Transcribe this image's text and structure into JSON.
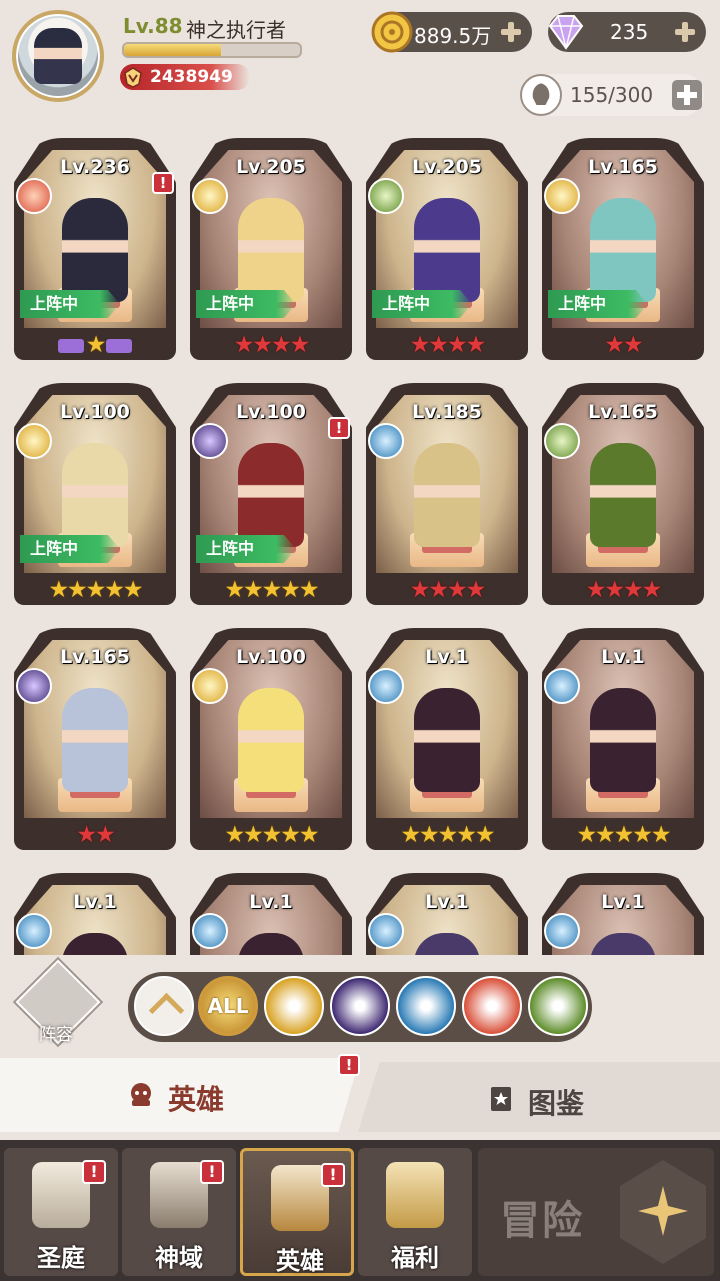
{
  "player": {
    "level": "Lv.88",
    "name": "神之执行者",
    "exp_fraction": 0.55,
    "power": "2438949"
  },
  "currency": {
    "gold": "889.5万",
    "diamond": "235"
  },
  "hero_capacity": "155/300",
  "heroes": [
    {
      "level": "Lv.236",
      "faction": "fire",
      "deployed": true,
      "alert": true,
      "stars": "★",
      "star_color": "purple",
      "sprite": "#2b2a3d"
    },
    {
      "level": "Lv.205",
      "faction": "holy",
      "deployed": true,
      "alert": false,
      "stars": "★★★★",
      "star_color": "red",
      "sprite": "#f0d38a"
    },
    {
      "level": "Lv.205",
      "faction": "nature",
      "deployed": true,
      "alert": false,
      "stars": "★★★★",
      "star_color": "red",
      "sprite": "#4c3a8c"
    },
    {
      "level": "Lv.165",
      "faction": "holy",
      "deployed": true,
      "alert": false,
      "stars": "★★",
      "star_color": "red",
      "sprite": "#7fc6c0"
    },
    {
      "level": "Lv.100",
      "faction": "holy",
      "deployed": true,
      "alert": false,
      "stars": "★★★★★",
      "star_color": "gold",
      "sprite": "#e9d9a8"
    },
    {
      "level": "Lv.100",
      "faction": "dark",
      "deployed": true,
      "alert": true,
      "stars": "★★★★★",
      "star_color": "gold",
      "sprite": "#8c2b2b"
    },
    {
      "level": "Lv.185",
      "faction": "order",
      "deployed": false,
      "alert": false,
      "stars": "★★★★",
      "star_color": "red",
      "sprite": "#d8c288"
    },
    {
      "level": "Lv.165",
      "faction": "nature",
      "deployed": false,
      "alert": false,
      "stars": "★★★★",
      "star_color": "red",
      "sprite": "#5b7a2c"
    },
    {
      "level": "Lv.165",
      "faction": "dark",
      "deployed": false,
      "alert": false,
      "stars": "★★",
      "star_color": "red",
      "sprite": "#b8c2d8"
    },
    {
      "level": "Lv.100",
      "faction": "holy",
      "deployed": false,
      "alert": false,
      "stars": "★★★★★",
      "star_color": "gold",
      "sprite": "#f4df7a"
    },
    {
      "level": "Lv.1",
      "faction": "order",
      "deployed": false,
      "alert": false,
      "stars": "★★★★★",
      "star_color": "gold",
      "sprite": "#3a2230"
    },
    {
      "level": "Lv.1",
      "faction": "order",
      "deployed": false,
      "alert": false,
      "stars": "★★★★★",
      "star_color": "gold",
      "sprite": "#3a2230"
    },
    {
      "level": "Lv.1",
      "faction": "order",
      "deployed": false,
      "alert": false,
      "stars": "",
      "star_color": "gold",
      "sprite": "#3a2230"
    },
    {
      "level": "Lv.1",
      "faction": "order",
      "deployed": false,
      "alert": false,
      "stars": "",
      "star_color": "gold",
      "sprite": "#3a2230"
    },
    {
      "level": "Lv.1",
      "faction": "order",
      "deployed": false,
      "alert": false,
      "stars": "",
      "star_color": "gold",
      "sprite": "#4a3a6a"
    },
    {
      "level": "Lv.1",
      "faction": "order",
      "deployed": false,
      "alert": false,
      "stars": "",
      "star_color": "gold",
      "sprite": "#4a3a6a"
    }
  ],
  "deployed_label": "上阵中",
  "alert_mark": "!",
  "lineup_label": "阵容",
  "filters": {
    "all_label": "ALL",
    "items": [
      "holy",
      "dark",
      "order",
      "fire",
      "nature"
    ]
  },
  "tabs": {
    "hero": "英雄",
    "codex": "图鉴"
  },
  "nav": {
    "items": [
      {
        "label": "圣庭",
        "alert": true
      },
      {
        "label": "神域",
        "alert": true
      },
      {
        "label": "英雄",
        "alert": true,
        "active": true
      },
      {
        "label": "福利",
        "alert": false
      }
    ],
    "adventure": "冒险"
  },
  "colors": {
    "holy": "#d9a325",
    "fire": "#d9513a",
    "dark": "#3f2a73",
    "nature": "#5f8e2c",
    "order": "#2a7bb5"
  }
}
